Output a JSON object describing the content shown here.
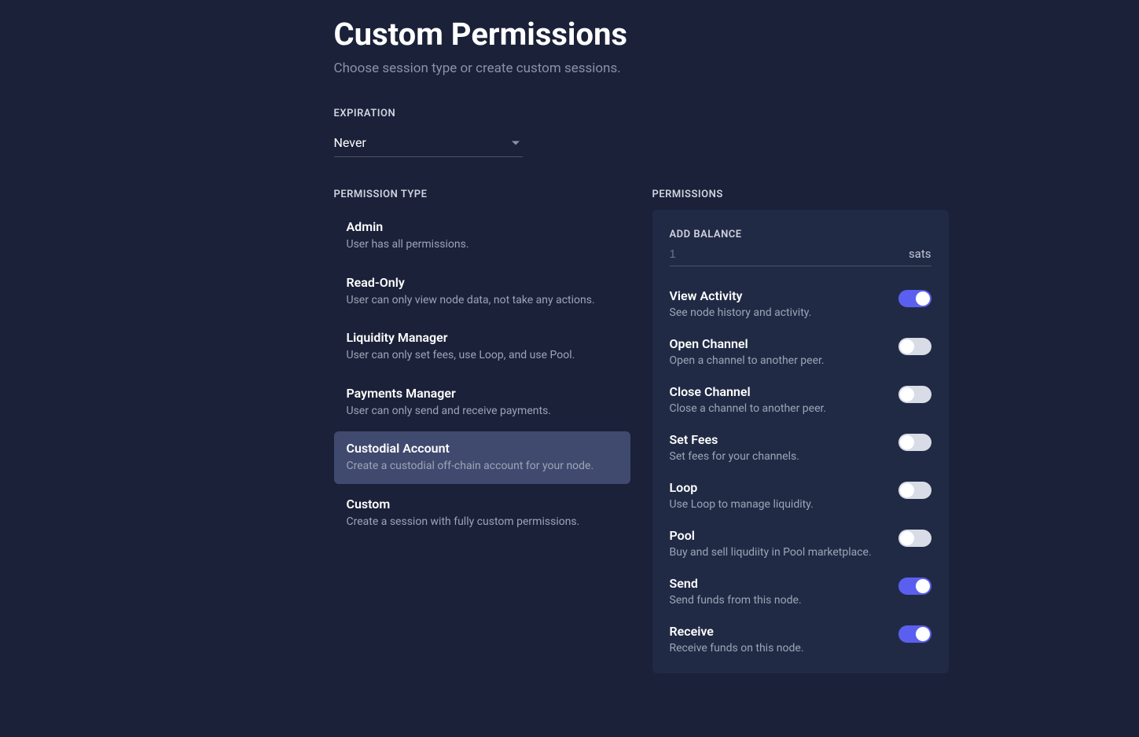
{
  "header": {
    "title": "Custom Permissions",
    "subtitle": "Choose session type or create custom sessions."
  },
  "expiration": {
    "label": "EXPIRATION",
    "value": "Never"
  },
  "permission_type": {
    "label": "PERMISSION TYPE",
    "selected_index": 4,
    "items": [
      {
        "title": "Admin",
        "desc": "User has all permissions."
      },
      {
        "title": "Read-Only",
        "desc": "User can only view node data, not take any actions."
      },
      {
        "title": "Liquidity Manager",
        "desc": "User can only set fees, use Loop, and use Pool."
      },
      {
        "title": "Payments Manager",
        "desc": "User can only send and receive payments."
      },
      {
        "title": "Custodial Account",
        "desc": "Create a custodial off-chain account for your node."
      },
      {
        "title": "Custom",
        "desc": "Create a session with fully custom permissions."
      }
    ]
  },
  "permissions": {
    "label": "PERMISSIONS",
    "balance": {
      "label": "ADD BALANCE",
      "placeholder": "1",
      "unit": "sats"
    },
    "items": [
      {
        "title": "View Activity",
        "desc": "See node history and activity.",
        "on": true
      },
      {
        "title": "Open Channel",
        "desc": "Open a channel to another peer.",
        "on": false
      },
      {
        "title": "Close Channel",
        "desc": "Close a channel to another peer.",
        "on": false
      },
      {
        "title": "Set Fees",
        "desc": "Set fees for your channels.",
        "on": false
      },
      {
        "title": "Loop",
        "desc": "Use Loop to manage liquidity.",
        "on": false
      },
      {
        "title": "Pool",
        "desc": "Buy and sell liqudiity in Pool marketplace.",
        "on": false
      },
      {
        "title": "Send",
        "desc": "Send funds from this node.",
        "on": true
      },
      {
        "title": "Receive",
        "desc": "Receive funds on this node.",
        "on": true
      }
    ]
  }
}
